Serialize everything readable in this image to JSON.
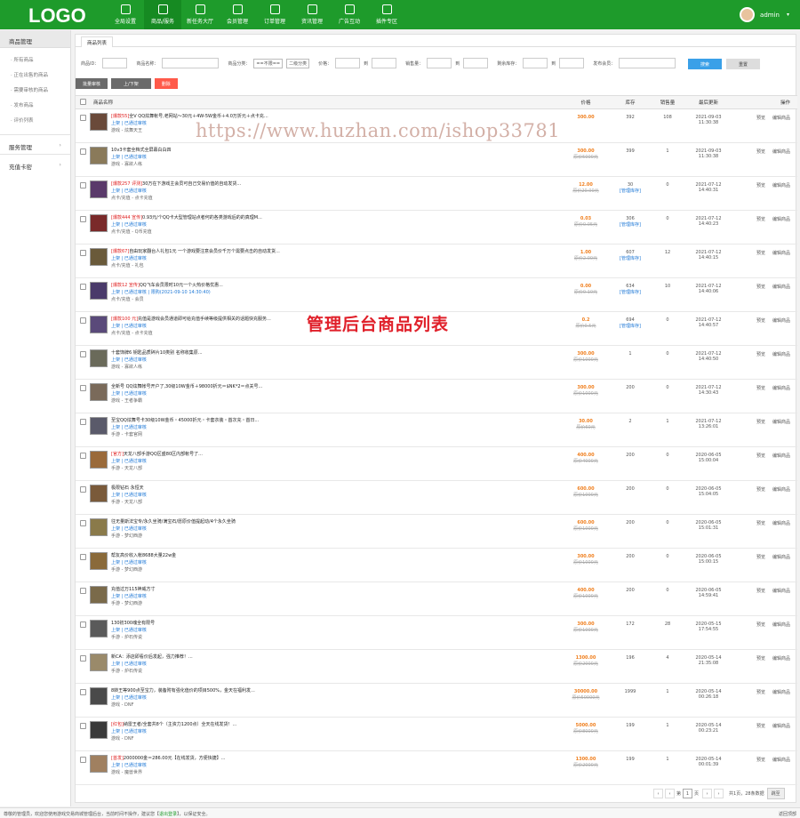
{
  "brand": {
    "logo": "LOGO"
  },
  "nav": [
    {
      "label": "全局设置",
      "icon": "grid-icon"
    },
    {
      "label": "商品/服务",
      "icon": "user-icon"
    },
    {
      "label": "新任务大厅",
      "icon": "copy-icon"
    },
    {
      "label": "会员管理",
      "icon": "list-icon"
    },
    {
      "label": "订单管理",
      "icon": "camera-icon"
    },
    {
      "label": "资讯管理",
      "icon": "doc-icon"
    },
    {
      "label": "广告互动",
      "icon": "chart-icon"
    },
    {
      "label": "插件专区",
      "icon": "bag-icon"
    }
  ],
  "user": {
    "name": "admin"
  },
  "sidebar": {
    "head": "商品管理",
    "items": [
      "所有商品",
      "正在出售的商品",
      "需要审核的商品",
      "发布商品",
      "评价列表"
    ],
    "groups": [
      "服务管理",
      "充值卡密"
    ]
  },
  "tab": "商品列表",
  "filters": {
    "id_label": "商品ID：",
    "name_label": "商品名称：",
    "cat_label": "商品分类：",
    "cat_select": "==不限==",
    "cat2_select": "二级分类",
    "price_label": "价格：",
    "to": "到",
    "sales_label": "销售量：",
    "stock_label": "剩余库存：",
    "pub_label": "发布会员：",
    "search": "搜索",
    "reset": "重置"
  },
  "actions": {
    "batch": "批量审核",
    "updown": "上/下架",
    "delete": "删除"
  },
  "columns": {
    "name": "商品名称",
    "price": "价格",
    "stock": "库存",
    "sold": "销售量",
    "updated": "最后更新",
    "op": "操作"
  },
  "rows": [
    {
      "tag": "[爆款55]",
      "title": "全V QQ炫舞帐号,老网站～30元＋4W-5W金币＋4.0万折元＋点卡充...",
      "status": "上架 | 已通过审核",
      "game": "游戏 - 炫舞天王",
      "price": "300.00",
      "oprice": "",
      "stock": "392",
      "stock_link": "",
      "sold": "108",
      "date": "2021-09-03",
      "time": "11:30:38",
      "op1": "预览",
      "op2": "编辑商品"
    },
    {
      "tag": "",
      "title": "10v3卡套全档式全屏幕白白四",
      "status": "上架 | 已通过审核",
      "game": "游戏 - 寡欲人练",
      "price": "300.00",
      "oprice": "原价5000元",
      "stock": "399",
      "stock_link": "",
      "sold": "1",
      "date": "2021-09-03",
      "time": "11:30:38",
      "op1": "预览",
      "op2": "编辑商品"
    },
    {
      "tag": "[爆款257 评测]",
      "title": "30万在下游戏主会员可自己交易价值的自动发货...",
      "status": "上架 | 已通过审核",
      "game": "点卡/充值 - 点卡充值",
      "price": "12.00",
      "oprice": "原价20.00元",
      "stock": "30",
      "stock_link": "[管理库存]",
      "sold": "0",
      "date": "2021-07-12",
      "time": "14:40:31",
      "op1": "预览",
      "op2": "编辑商品"
    },
    {
      "tag": "[爆款444 宣传]",
      "title": "0.93元/个QQ卡大型管理站点者何的各类游戏后的的真理M...",
      "status": "上架 | 已通过审核",
      "game": "点卡/充值 - Q币充值",
      "price": "0.03",
      "oprice": "原价0.05元",
      "stock": "306",
      "stock_link": "[管理库存]",
      "sold": "0",
      "date": "2021-07-12",
      "time": "14:40:23",
      "op1": "预览",
      "op2": "编辑商品"
    },
    {
      "tag": "[爆款67]",
      "title": "自由玩家翻台人礼包1元 一个游戏要注意会员价千万个需要点击的自动发货...",
      "status": "上架 | 已通过审核",
      "game": "点卡/充值 - 礼包",
      "price": "1.00",
      "oprice": "原价2.00元",
      "stock": "607",
      "stock_link": "[管理库存]",
      "sold": "12",
      "date": "2021-07-12",
      "time": "14:40:15",
      "op1": "预览",
      "op2": "编辑商品"
    },
    {
      "tag": "[爆款12 宣传]",
      "title": "QQ飞车会员限时10元一个火热价格优惠...",
      "status": "上架 | 已通过审核 | 限购(2021-09-10 14:30:40)",
      "game": "点卡/充值 - 会员",
      "price": "0.00",
      "oprice": "原价0.10元",
      "stock": "634",
      "stock_link": "[管理库存]",
      "sold": "10",
      "date": "2021-07-12",
      "time": "14:40:06",
      "op1": "预览",
      "op2": "编辑商品"
    },
    {
      "tag": "[爆款100 元]",
      "title": "充值是游戏会员通道即可给充值手续等级提供相关的话题快充服务...",
      "status": "上架 | 已通过审核",
      "game": "点卡/充值 - 点卡充值",
      "price": "0.2",
      "oprice": "原价0.5元",
      "stock": "694",
      "stock_link": "[管理库存]",
      "sold": "0",
      "date": "2021-07-12",
      "time": "14:40:57",
      "op1": "预览",
      "op2": "编辑商品"
    },
    {
      "tag": "",
      "title": "十套饰牌6 钥匙品质碎片10类别 名称收集原...",
      "status": "上架 | 已通过审核",
      "game": "游戏 - 寡欲人练",
      "price": "300.00",
      "oprice": "原价1000元",
      "stock": "1",
      "stock_link": "",
      "sold": "0",
      "date": "2021-07-12",
      "time": "14:40:50",
      "op1": "预览",
      "op2": "编辑商品"
    },
    {
      "tag": "",
      "title": "全新号 QQ炫舞帐号开户了,30级10W金币＋98000折元＝$NK*2＝点关号...",
      "status": "上架 | 已通过审核",
      "game": "游戏 - 王者争霸",
      "price": "300.00",
      "oprice": "原价1000元",
      "stock": "200",
      "stock_link": "",
      "sold": "0",
      "date": "2021-07-12",
      "time": "14:30:43",
      "op1": "预览",
      "op2": "编辑商品"
    },
    {
      "tag": "",
      "title": "至宝QQ炫舞号卡30级10W金币・45000折元・卡套衣装・首次充・首日...",
      "status": "上架 | 已通过审核",
      "game": "手游 - 卡套官网",
      "price": "30.00",
      "oprice": "原价60元",
      "stock": "2",
      "stock_link": "",
      "sold": "1",
      "date": "2021-07-12",
      "time": "13:26:01",
      "op1": "预览",
      "op2": "编辑商品"
    },
    {
      "tag": "[官方]",
      "title": "天龙八部手游QQ区盛80区内部帐号了...",
      "status": "上架 | 已通过审核",
      "game": "手游 - 天龙八部",
      "price": "400.00",
      "oprice": "原价4000元",
      "stock": "200",
      "stock_link": "",
      "sold": "0",
      "date": "2020-06-05",
      "time": "15:00:04",
      "op1": "预览",
      "op2": "编辑商品"
    },
    {
      "tag": "",
      "title": "极限钻石 永恒天",
      "status": "上架 | 已通过审核",
      "game": "手游 - 天龙八部",
      "price": "600.00",
      "oprice": "原价1000元",
      "stock": "200",
      "stock_link": "",
      "sold": "0",
      "date": "2020-06-05",
      "time": "15:04:05",
      "op1": "预览",
      "op2": "编辑商品"
    },
    {
      "tag": "",
      "title": "往无量斯法宝专/永久坐骑/满宝石/愿原价值提起动/4个永久坐骑",
      "status": "上架 | 已通过审核",
      "game": "手游 - 梦幻西游",
      "price": "600.00",
      "oprice": "原价1000元",
      "stock": "200",
      "stock_link": "",
      "sold": "0",
      "date": "2020-06-05",
      "time": "15:01:31",
      "op1": "预览",
      "op2": "编辑商品"
    },
    {
      "tag": "",
      "title": "帮友高价收入帐8688大量22w金",
      "status": "上架 | 已通过审核",
      "game": "手游 - 梦幻西游",
      "price": "300.00",
      "oprice": "原价1000元",
      "stock": "200",
      "stock_link": "",
      "sold": "0",
      "date": "2020-06-05",
      "time": "15:00:15",
      "op1": "预览",
      "op2": "编辑商品"
    },
    {
      "tag": "",
      "title": "充值过万115神威方寸",
      "status": "上架 | 已通过审核",
      "game": "手游 - 梦幻西游",
      "price": "400.00",
      "oprice": "原价1000元",
      "stock": "200",
      "stock_link": "",
      "sold": "0",
      "date": "2020-06-05",
      "time": "14:59:41",
      "op1": "预览",
      "op2": "编辑商品"
    },
    {
      "tag": "",
      "title": "130初300魂全有限号",
      "status": "上架 | 已通过审核",
      "game": "手游 - 炉石传说",
      "price": "300.00",
      "oprice": "原价1000元",
      "stock": "172",
      "stock_link": "",
      "sold": "28",
      "date": "2020-05-15",
      "time": "17:54:55",
      "op1": "预览",
      "op2": "编辑商品"
    },
    {
      "tag": "",
      "title": "新CA：添店即看价后发起，强力推荐！...",
      "status": "上架 | 已通过审核",
      "game": "手游 - 炉石传说",
      "price": "1300.00",
      "oprice": "原价2000元",
      "stock": "196",
      "stock_link": "",
      "sold": "4",
      "date": "2020-05-14",
      "time": "21:35:08",
      "op1": "预览",
      "op2": "编辑商品"
    },
    {
      "tag": "",
      "title": "8转王等900点至宝力，装备附有强化值价的项目500%，金天在福利发...",
      "status": "上架 | 已通过审核",
      "game": "游戏 - DNF",
      "price": "30000.00",
      "oprice": "原价50000元",
      "stock": "1999",
      "stock_link": "",
      "sold": "1",
      "date": "2020-05-14",
      "time": "00:26:18",
      "op1": "预览",
      "op2": "编辑商品"
    },
    {
      "tag": "[红包]",
      "title": "纳雷王者/全套共8个（主资力1200点）全天在线发货！...",
      "status": "上架 | 已通过审核",
      "game": "游戏 - DNF",
      "price": "5000.00",
      "oprice": "原价8000元",
      "stock": "199",
      "stock_link": "",
      "sold": "1",
      "date": "2020-05-14",
      "time": "00:23:21",
      "op1": "预览",
      "op2": "编辑商品"
    },
    {
      "tag": "[首发]",
      "title": "2000000金＝286.00元【在线发货，方便快捷】...",
      "status": "上架 | 已通过审核",
      "game": "游戏 - 魔兽世界",
      "price": "1300.00",
      "oprice": "原价2000元",
      "stock": "199",
      "stock_link": "",
      "sold": "1",
      "date": "2020-05-14",
      "time": "00:01:39",
      "op1": "预览",
      "op2": "编辑商品"
    }
  ],
  "pager": {
    "page_label": "第",
    "page": "1",
    "page_suffix": "页",
    "total": "共1页，28条数据",
    "go": "跳至"
  },
  "footer": {
    "text": "尊敬的管理员，欢迎您使用游戏交易商城管理后台，当前时间不操作，建议您【",
    "link": "退出登录",
    "tail": "】，以保证安全。",
    "top": "返回顶部"
  },
  "watermark": "https://www.huzhan.com/ishop33781",
  "overlay_title": "管理后台商品列表",
  "colors": {
    "brand": "#1e9b2b",
    "accent": "#3aa0e8",
    "price": "#f08020",
    "danger": "#ff5a4a"
  }
}
